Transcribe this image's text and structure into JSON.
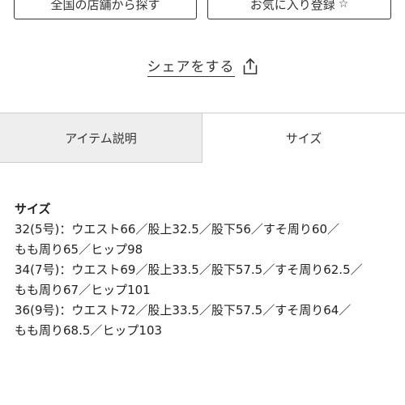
{
  "buttons": {
    "store_label": "全国の店舗から探す",
    "favorite_label": "お気に入り登録",
    "favorite_icon": "star-outline-icon"
  },
  "share": {
    "label": "シェアをする",
    "icon": "share-icon"
  },
  "tabs": [
    {
      "label": "アイテム説明",
      "active": false
    },
    {
      "label": "サイズ",
      "active": true
    }
  ],
  "size_section": {
    "heading": "サイズ",
    "lines": [
      "32(5号)：ウエスト66／股上32.5／股下56／すそ周り60／",
      "もも周り65／ヒップ98",
      "34(7号)：ウエスト69／股上33.5／股下57.5／すそ周り62.5／",
      "もも周り67／ヒップ101",
      "36(9号)：ウエスト72／股上33.5／股下57.5／すそ周り64／",
      "もも周り68.5／ヒップ103"
    ]
  },
  "colors": {
    "active_tab_bg": "#ffffff",
    "inactive_tab_bg": "#eeeeee",
    "border": "#cccccc",
    "text": "#222222"
  }
}
